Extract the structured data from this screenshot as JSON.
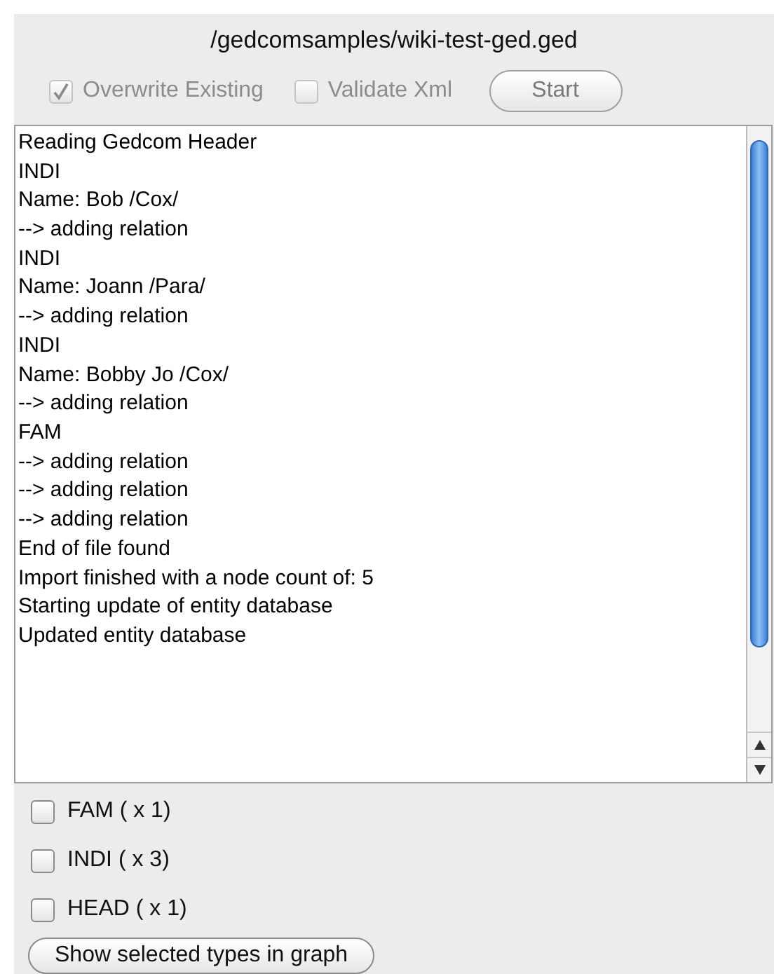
{
  "title": "/gedcomsamples/wiki-test-ged.ged",
  "options": [
    {
      "label": "Overwrite Existing",
      "checked": true,
      "disabled": true
    },
    {
      "label": "Validate Xml",
      "checked": false,
      "disabled": true
    }
  ],
  "start_button": {
    "label": "Start",
    "disabled": true
  },
  "log_lines": [
    "Reading Gedcom Header",
    "INDI",
    "Name: Bob /Cox/",
    "--> adding relation",
    "INDI",
    "Name: Joann /Para/",
    "--> adding relation",
    "INDI",
    "Name: Bobby Jo /Cox/",
    "--> adding relation",
    "FAM",
    "--> adding relation",
    "--> adding relation",
    "--> adding relation",
    "End of file found",
    "Import finished with a node count of: 5",
    "Starting update of entity database",
    "Updated entity database"
  ],
  "types": [
    {
      "label": "FAM ( x 1)",
      "checked": false
    },
    {
      "label": "INDI ( x 3)",
      "checked": false
    },
    {
      "label": "HEAD ( x 1)",
      "checked": false
    }
  ],
  "graph_button": {
    "label": "Show selected types in graph"
  }
}
